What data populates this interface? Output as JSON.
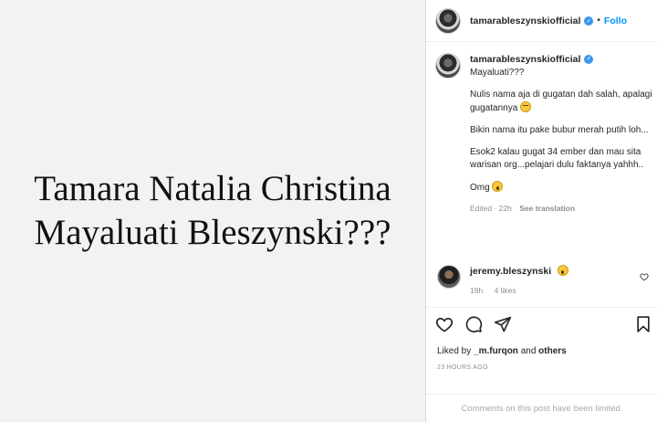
{
  "post": {
    "line1": "Tamara Natalia Christina",
    "line2": "Mayaluati Bleszynski???"
  },
  "header": {
    "username": "tamarableszynskiofficial",
    "separator": "•",
    "follow_label": "Follo"
  },
  "caption": {
    "username": "tamarableszynskiofficial",
    "p1": "Mayaluati???",
    "p2": "Nulis nama aja di gugatan dah salah, apalagi gugatannya",
    "p3": "Bikin nama itu pake bubur merah putih loh...",
    "p4": "Esok2 kalau gugat 34 ember dan mau sita warisan org...pelajari dulu faktanya yahhh..",
    "p5": "Omg",
    "edited": "Edited · 22h",
    "see_translation": "See translation"
  },
  "comment": {
    "username": "jeremy.bleszynski",
    "time": "19h",
    "likes": "4 likes"
  },
  "footer": {
    "liked_by_prefix": "Liked by",
    "liked_by_user": "_m.furqon",
    "liked_by_and": "and",
    "liked_by_others": "others",
    "time_ago": "23 HOURS AGO",
    "comments_limited": "Comments on this post have been limited."
  },
  "colors": {
    "link": "#0095f6",
    "verified": "#3897f0",
    "muted": "#8e8e8e"
  }
}
